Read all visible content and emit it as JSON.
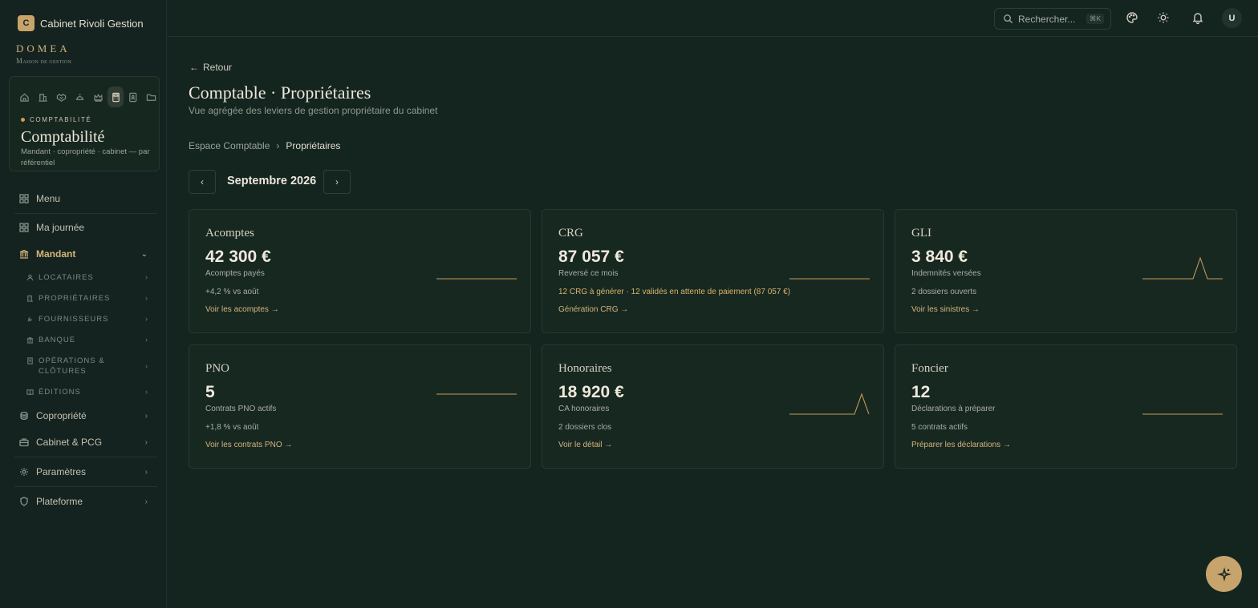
{
  "workspace": {
    "logo_letter": "C",
    "name": "Cabinet Rivoli Gestion"
  },
  "brand": {
    "name": "DOMEA",
    "tagline": "Maison de gestion"
  },
  "module": {
    "icons": [
      "home-icon",
      "building-icon",
      "handshake-icon",
      "service-bell-icon",
      "crown-icon",
      "calculator-icon",
      "contact-book-icon",
      "folder-icon"
    ],
    "active_icon": "calculator-icon",
    "kicker": "COMPTABILITÉ",
    "title": "Comptabilité",
    "description": "Mandant · copropriété · cabinet — par référentiel"
  },
  "nav": {
    "menu": "Menu",
    "ma_journee": "Ma journée",
    "mandant": "Mandant",
    "sub": {
      "locataires": "LOCATAIRES",
      "proprietaires": "PROPRIÉTAIRES",
      "fournisseurs": "FOURNISSEURS",
      "banque": "BANQUE",
      "operations": "OPÉRATIONS & CLÔTURES",
      "editions": "ÉDITIONS"
    },
    "copropriete": "Copropriété",
    "cabinet": "Cabinet & PCG",
    "parametres": "Paramètres",
    "plateforme": "Plateforme"
  },
  "topbar": {
    "search_placeholder": "Rechercher...",
    "shortcut": "⌘K",
    "avatar_initial": "U"
  },
  "page": {
    "back": "Retour",
    "title": "Comptable · Propriétaires",
    "subtitle": "Vue agrégée des leviers de gestion propriétaire du cabinet",
    "breadcrumb": [
      "Espace Comptable",
      "Propriétaires"
    ],
    "month": "Septembre 2026"
  },
  "cards": [
    {
      "title": "Acomptes",
      "value": "42 300 €",
      "label": "Acomptes payés",
      "note": "+4,2 % vs août",
      "note_accent": false,
      "link": "Voir les acomptes →"
    },
    {
      "title": "CRG",
      "value": "87 057 €",
      "label": "Reversé ce mois",
      "note": "12 CRG à générer · 12 validés en attente de paiement (87 057 €)",
      "note_accent": true,
      "link": "Génération CRG →"
    },
    {
      "title": "GLI",
      "value": "3 840 €",
      "label": "Indemnités versées",
      "note": "2 dossiers ouverts",
      "note_accent": false,
      "link": "Voir les sinistres →"
    },
    {
      "title": "PNO",
      "value": "5",
      "label": "Contrats PNO actifs",
      "note": "+1,8 % vs août",
      "note_accent": false,
      "link": "Voir les contrats PNO →"
    },
    {
      "title": "Honoraires",
      "value": "18 920 €",
      "label": "CA honoraires",
      "note": "2 dossiers clos",
      "note_accent": false,
      "link": "Voir le détail →"
    },
    {
      "title": "Foncier",
      "value": "12",
      "label": "Déclarations à préparer",
      "note": "5 contrats actifs",
      "note_accent": false,
      "link": "Préparer les déclarations →"
    }
  ],
  "colors": {
    "accent": "#c7a46b",
    "background": "#142520",
    "sparkline": "#c39b58"
  }
}
